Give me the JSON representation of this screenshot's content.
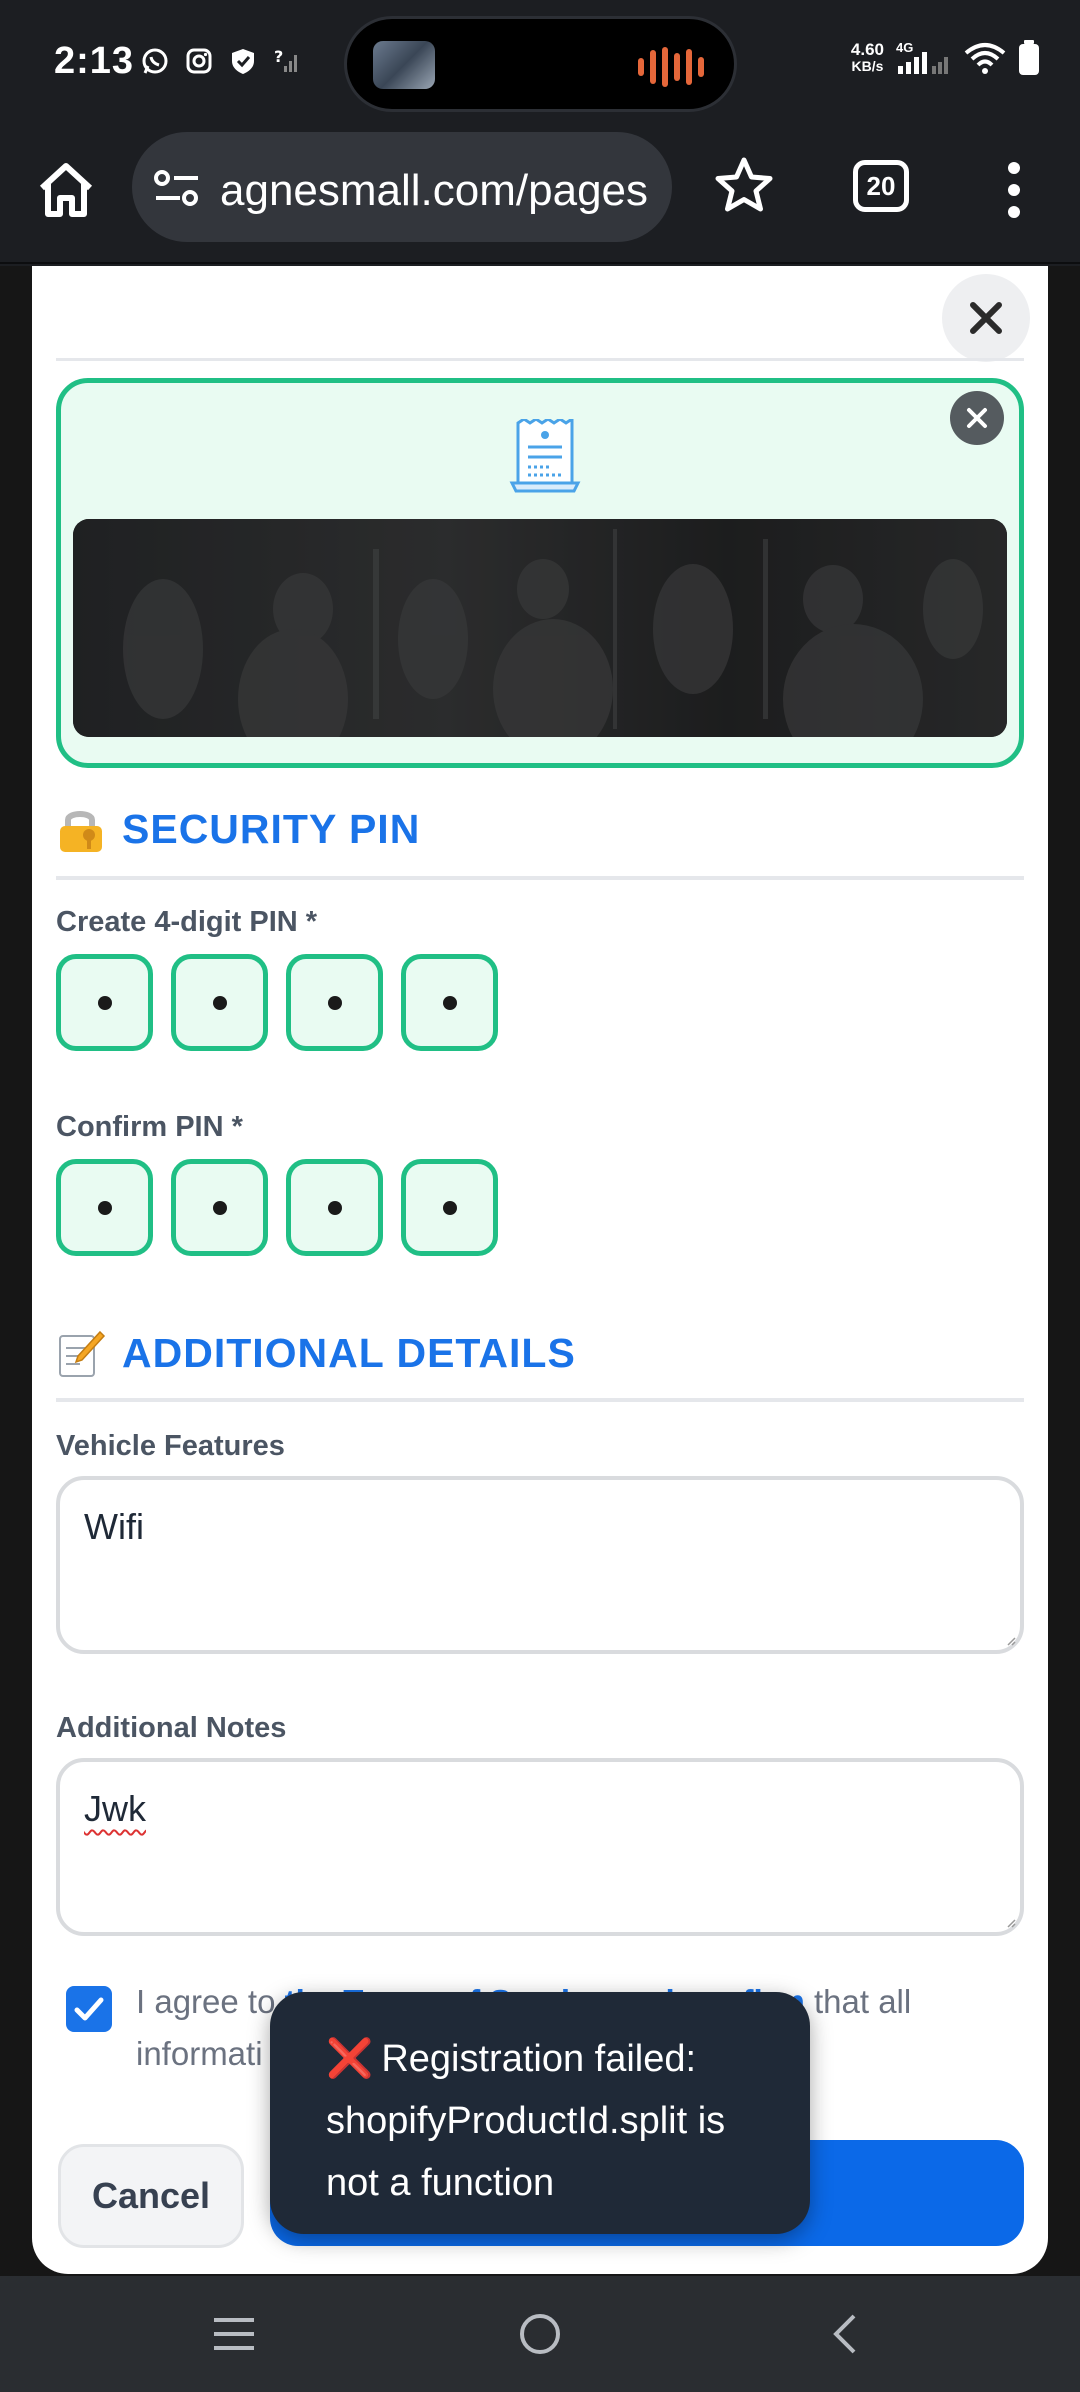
{
  "status_bar": {
    "time": "2:13",
    "net_speed_value": "4.60",
    "net_speed_unit": "KB/s",
    "network_type": "4G",
    "icons": [
      "whatsapp-icon",
      "instagram-icon",
      "shield-icon",
      "signal-question-icon",
      "sound-wave-icon",
      "signal-icon",
      "wifi-icon",
      "battery-icon"
    ]
  },
  "browser": {
    "url": "agnesmall.com/pages",
    "tab_count": "20"
  },
  "receipt": {
    "icon": "receipt-icon"
  },
  "security": {
    "title": "SECURITY PIN",
    "emoji": "🔐",
    "create_label": "Create 4-digit PIN *",
    "confirm_label": "Confirm PIN *"
  },
  "details": {
    "title": "ADDITIONAL DETAILS",
    "emoji": "📝",
    "features_label": "Vehicle Features",
    "features_value": "Wifi",
    "notes_label": "Additional Notes",
    "notes_value": "Jwk"
  },
  "agreement": {
    "text_before": "I agree to ",
    "text_hidden": "the Terms of Service and confirm",
    "text_after": " that all",
    "text_line2": "informati",
    "checked": true
  },
  "buttons": {
    "cancel": "Cancel"
  },
  "toast": {
    "icon": "❌",
    "message": "Registration failed: shopifyProductId.split is not a function"
  },
  "colors": {
    "accent": "#1a73e8",
    "pin_border": "#20bf85",
    "pin_bg": "#e9fbf2",
    "toast_bg": "#1f2937"
  }
}
